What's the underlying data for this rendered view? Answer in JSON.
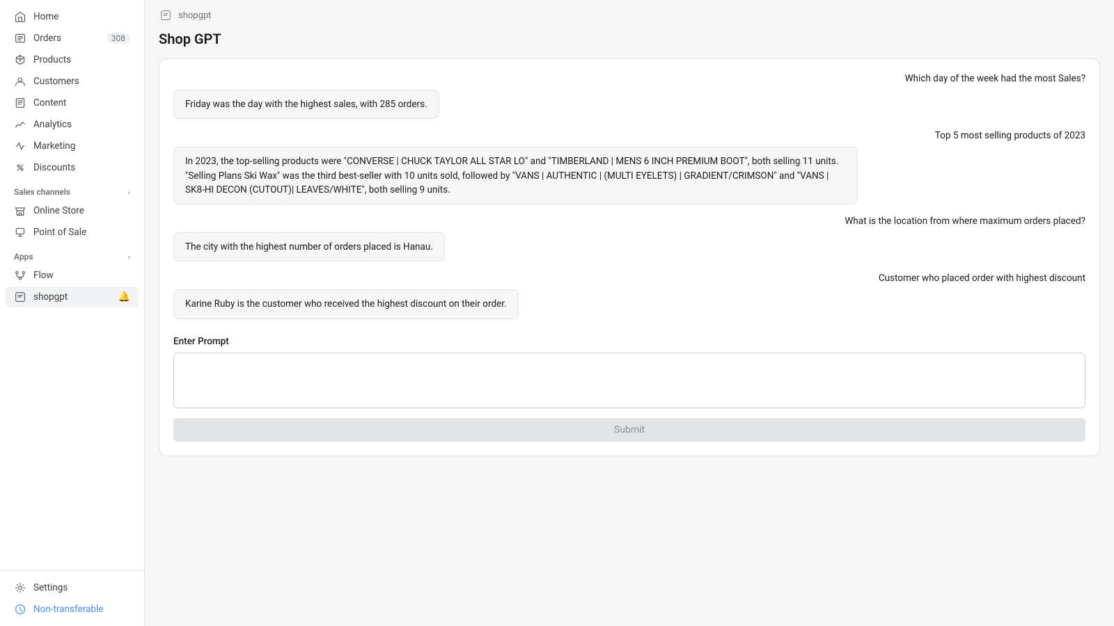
{
  "sidebar": {
    "nav_items": [
      {
        "id": "home",
        "label": "Home",
        "icon": "home"
      },
      {
        "id": "orders",
        "label": "Orders",
        "icon": "orders",
        "badge": "308"
      },
      {
        "id": "products",
        "label": "Products",
        "icon": "products"
      },
      {
        "id": "customers",
        "label": "Customers",
        "icon": "customers"
      },
      {
        "id": "content",
        "label": "Content",
        "icon": "content"
      },
      {
        "id": "analytics",
        "label": "Analytics",
        "icon": "analytics"
      },
      {
        "id": "marketing",
        "label": "Marketing",
        "icon": "marketing"
      },
      {
        "id": "discounts",
        "label": "Discounts",
        "icon": "discounts"
      }
    ],
    "sales_channels_label": "Sales channels",
    "sales_channels": [
      {
        "id": "online-store",
        "label": "Online Store",
        "icon": "store"
      },
      {
        "id": "point-of-sale",
        "label": "Point of Sale",
        "icon": "pos"
      }
    ],
    "apps_label": "Apps",
    "apps": [
      {
        "id": "flow",
        "label": "Flow",
        "icon": "flow"
      }
    ],
    "shopgpt_label": "shopgpt",
    "settings_label": "Settings",
    "non_transferable_label": "Non-transferable"
  },
  "topbar": {
    "app_name": "shopgpt"
  },
  "page": {
    "title": "Shop GPT"
  },
  "chat": {
    "messages": [
      {
        "user": "Which day of the week had the most Sales?",
        "assistant": "Friday was the day with the highest sales, with 285 orders."
      },
      {
        "user": "Top 5 most selling products of 2023",
        "assistant": "In 2023, the top-selling products were \"CONVERSE | CHUCK TAYLOR ALL STAR LO\" and \"TIMBERLAND | MENS 6 INCH PREMIUM BOOT\", both selling 11 units. \"Selling Plans Ski Wax\" was the third best-seller with 10 units sold, followed by \"VANS | AUTHENTIC | (MULTI EYELETS) | GRADIENT/CRIMSON\" and \"VANS | SK8-HI DECON (CUTOUT)| LEAVES/WHITE\", both selling 9 units."
      },
      {
        "user": "What is the location from where maximum orders placed?",
        "assistant": "The city with the highest number of orders placed is Hanau."
      },
      {
        "user": "Customer who placed order with highest discount",
        "assistant": "Karine Ruby is the customer who received the highest discount on their order."
      }
    ],
    "prompt_label": "Enter Prompt",
    "prompt_placeholder": "",
    "submit_label": "Submit"
  }
}
